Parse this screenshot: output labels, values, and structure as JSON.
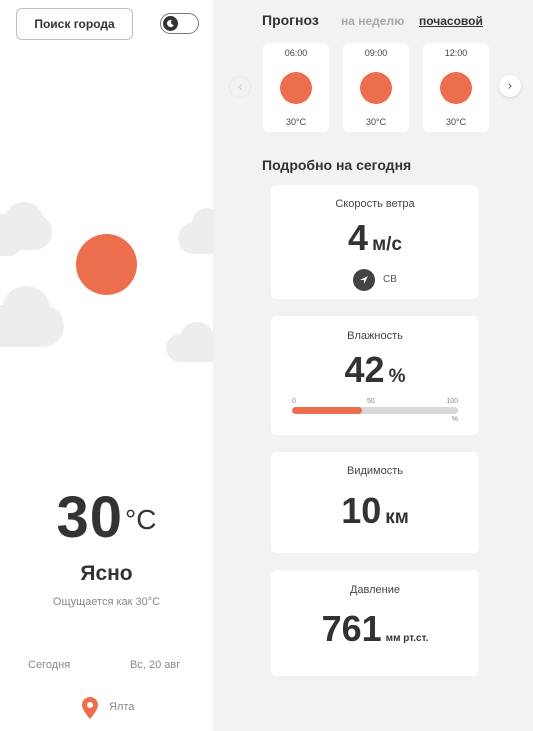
{
  "colors": {
    "accent": "#ec6e4c",
    "panel": "#ffffff",
    "background": "#f2f2f2",
    "text": "#333333"
  },
  "left": {
    "search_button": "Поиск города",
    "theme_toggle_icon": "moon-icon",
    "temperature": "30",
    "temperature_unit": "°C",
    "condition": "Ясно",
    "feels_like": "Ощущается как 30°C",
    "day_label": "Сегодня",
    "date": "Вс, 20 авг",
    "location": "Ялта",
    "location_icon": "map-pin-icon"
  },
  "forecast": {
    "title": "Прогноз",
    "tabs": [
      {
        "label": "на неделю",
        "active": false
      },
      {
        "label": "почасовой",
        "active": true
      }
    ],
    "hours": [
      {
        "time": "06:00",
        "temp": "30°C",
        "icon": "sun-icon"
      },
      {
        "time": "09:00",
        "temp": "30°C",
        "icon": "sun-icon"
      },
      {
        "time": "12:00",
        "temp": "30°C",
        "icon": "sun-icon"
      }
    ],
    "prev_icon": "chevron-left-icon",
    "next_icon": "chevron-right-icon"
  },
  "details": {
    "title": "Подробно на сегодня",
    "wind": {
      "label": "Скорость ветра",
      "value": "4",
      "unit": "м/с",
      "direction": "СВ",
      "direction_icon": "navigation-arrow-icon"
    },
    "humidity": {
      "label": "Влажность",
      "value": "42",
      "unit": "%",
      "scale": [
        "0",
        "50",
        "100"
      ],
      "scale_unit": "%",
      "fraction": 0.42
    },
    "visibility": {
      "label": "Видимость",
      "value": "10",
      "unit": "км"
    },
    "pressure": {
      "label": "Давление",
      "value": "761",
      "unit": "мм рт.ст."
    }
  }
}
